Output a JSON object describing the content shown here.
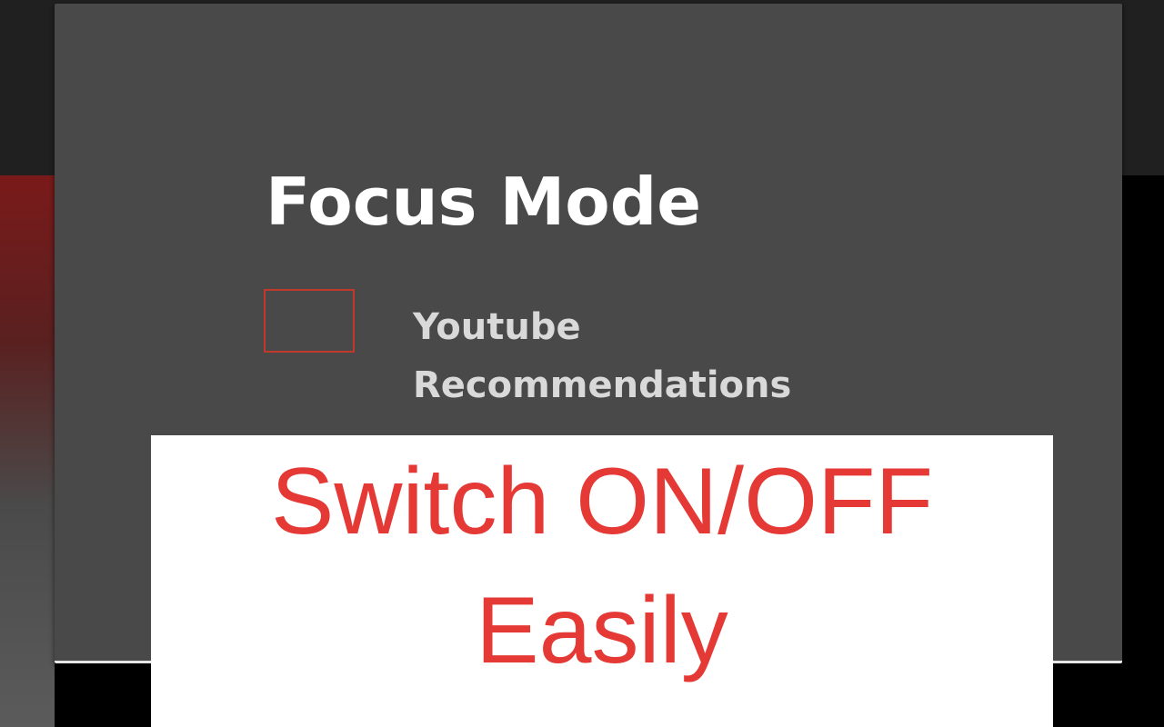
{
  "popup": {
    "title": "Focus Mode",
    "option": {
      "label_line1": "Youtube",
      "label_line2": "Recommendations",
      "checked": false
    }
  },
  "banner": {
    "line1": "Switch ON/OFF",
    "line2": "Easily"
  },
  "colors": {
    "popup_bg": "#494949",
    "accent_red": "#e53935",
    "checkbox_border": "#c0392b",
    "title_text": "#ffffff",
    "label_text": "#d9d9d9",
    "banner_bg": "#ffffff"
  }
}
